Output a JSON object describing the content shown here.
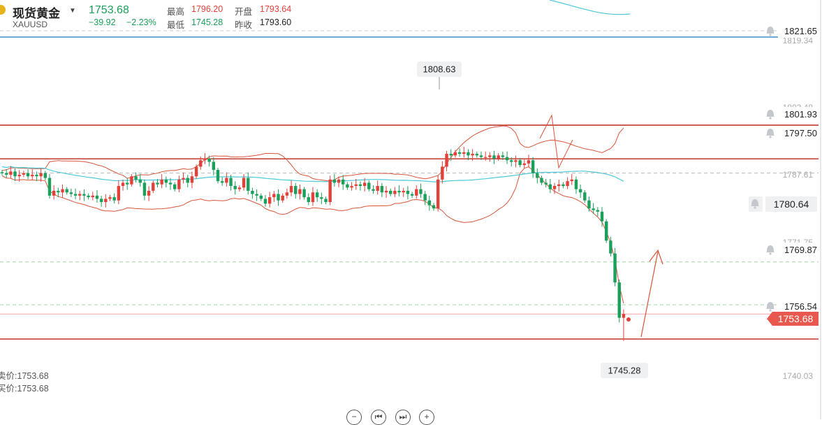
{
  "header": {
    "name": "现货黄金",
    "symbol": "XAUUSD",
    "last": "1753.68",
    "change": "−39.92",
    "change_pct": "−2.23%",
    "high_label": "最高",
    "high": "1796.20",
    "open_label": "开盘",
    "open": "1793.64",
    "low_label": "最低",
    "low": "1745.28",
    "prev_label": "昨收",
    "prev_close": "1793.60"
  },
  "footer": {
    "bid": "卖价:1753.68",
    "ask": "买价:1753.68"
  },
  "icons": {
    "alert": "bell-icon",
    "zoom_out": "minus-icon",
    "start": "skip-start-icon",
    "end": "skip-end-icon",
    "zoom_in": "plus-icon"
  },
  "colors": {
    "up": "#e2413a",
    "down": "#1aa05a",
    "ma": "#4cc9d8",
    "band": "#d9553a",
    "level": "#c0392b"
  },
  "chart_data": {
    "type": "candlestick",
    "symbol": "XAUUSD",
    "axis_ticks": [
      "1819.34",
      "1803.48",
      "1787.61",
      "1771.75",
      "1740.03"
    ],
    "markers": {
      "period_high": "1808.63",
      "period_low": "1745.28",
      "last_price": "1753.68",
      "side_value": "1780.64"
    },
    "horizontal_levels": [
      {
        "value": 1821.65,
        "label": "1821.65",
        "style": "solid-blue"
      },
      {
        "value": 1812.4,
        "style": "solid-red"
      },
      {
        "value": 1801.93,
        "label": "1801.93",
        "style": "solid-red"
      },
      {
        "value": 1797.5,
        "label": "1797.50",
        "style": "dashed-gray"
      },
      {
        "value": 1769.87,
        "label": "1769.87",
        "style": "dashed-green"
      },
      {
        "value": 1756.54,
        "label": "1756.54",
        "style": "dashed-green"
      },
      {
        "value": 1753.68,
        "style": "solid-pink"
      },
      {
        "value": 1745.9,
        "style": "solid-red"
      }
    ],
    "closes": [
      1797.5,
      1797.0,
      1798.0,
      1796.5,
      1797.0,
      1797.5,
      1796.5,
      1797.0,
      1796.5,
      1797.5,
      1796.0,
      1790.5,
      1792.0,
      1791.5,
      1792.5,
      1791.5,
      1791.0,
      1790.5,
      1791.0,
      1790.5,
      1790.0,
      1790.5,
      1789.5,
      1788.5,
      1789.5,
      1790.0,
      1789.0,
      1793.5,
      1794.5,
      1794.0,
      1796.5,
      1795.5,
      1794.5,
      1790.5,
      1792.0,
      1794.5,
      1794.0,
      1795.5,
      1794.5,
      1794.0,
      1792.5,
      1795.5,
      1796.0,
      1794.5,
      1796.5,
      1799.5,
      1801.5,
      1802.0,
      1801.0,
      1798.5,
      1795.0,
      1794.5,
      1796.0,
      1793.5,
      1792.5,
      1793.0,
      1796.0,
      1792.0,
      1791.0,
      1790.5,
      1789.5,
      1788.0,
      1790.0,
      1791.0,
      1789.0,
      1790.5,
      1791.5,
      1793.5,
      1791.0,
      1792.5,
      1790.0,
      1788.5,
      1791.5,
      1790.0,
      1789.5,
      1788.5,
      1795.5,
      1794.5,
      1795.5,
      1794.0,
      1793.0,
      1793.5,
      1794.0,
      1793.5,
      1794.5,
      1792.5,
      1792.0,
      1793.5,
      1791.5,
      1792.0,
      1791.0,
      1792.0,
      1791.5,
      1792.0,
      1791.0,
      1790.5,
      1792.5,
      1791.0,
      1789.0,
      1787.5,
      1786.5,
      1795.5,
      1799.5,
      1803.5,
      1803.0,
      1804.0,
      1803.5,
      1804.0,
      1803.0,
      1803.5,
      1803.0,
      1802.5,
      1802.5,
      1803.0,
      1802.0,
      1803.0,
      1802.5,
      1801.5,
      1801.0,
      1801.5,
      1800.0,
      1800.5,
      1801.5,
      1797.5,
      1796.0,
      1794.5,
      1794.0,
      1792.5,
      1793.5,
      1794.0,
      1793.5,
      1795.0,
      1795.5,
      1792.5,
      1791.5,
      1789.0,
      1786.5,
      1786.0,
      1785.5,
      1782.5,
      1776.5,
      1772.5,
      1763.5,
      1752.5,
      1753.68
    ],
    "indicators": [
      "moving average",
      "bollinger bands"
    ],
    "grid": false,
    "legend": "none"
  }
}
